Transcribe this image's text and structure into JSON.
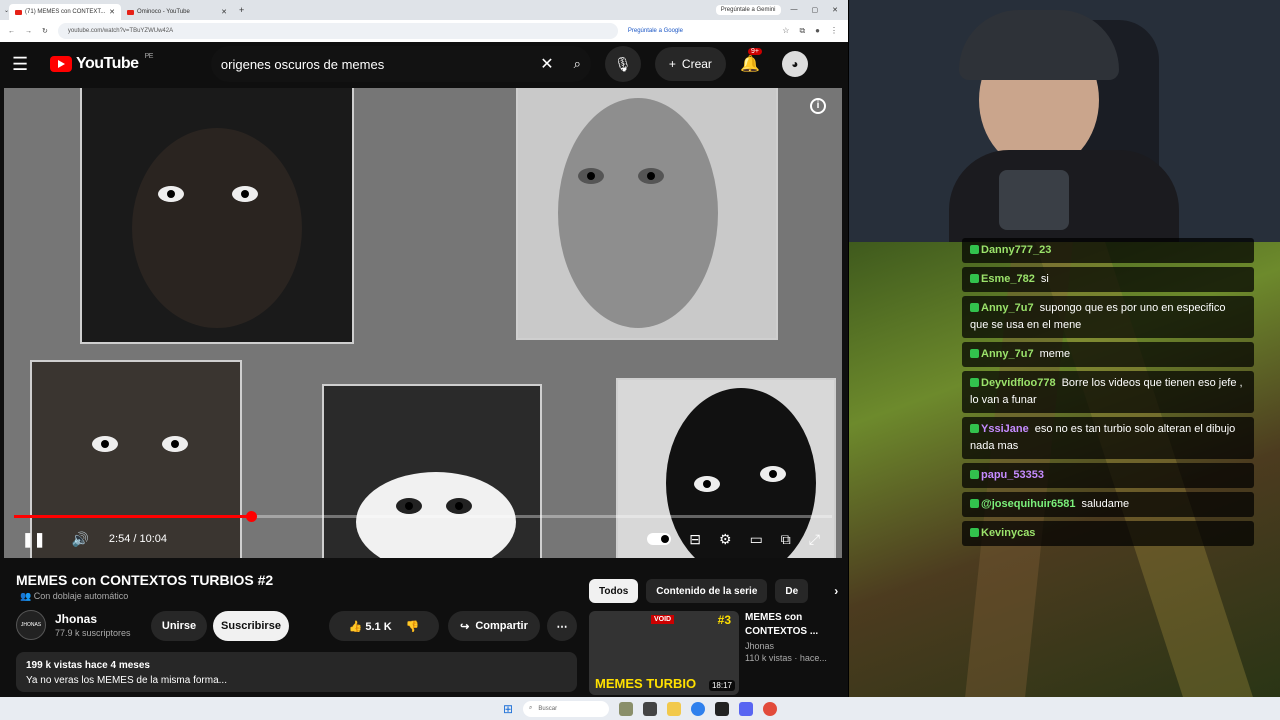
{
  "browser": {
    "tab_active": "(71) MEMES con CONTEXT...",
    "tab_inactive": "Ominoco - YouTube",
    "gemini_tab": "Pregúntale a Gemini",
    "url": "youtube.com/watch?v=TBuYZWUw42A",
    "gemini_omnibox": "Pregúntale a Google"
  },
  "youtube": {
    "logo": "YouTube",
    "region": "PE",
    "search_query": "origenes oscuros  de memes",
    "create_label": "Crear",
    "notif_badge": "9+",
    "player": {
      "time": "2:54 / 10:04",
      "progress": 0.29
    },
    "video": {
      "title": "MEMES con CONTEXTOS TURBIOS #2",
      "dubbing": "Con doblaje automático",
      "channel": "Jhonas",
      "subscribers": "77.9 k suscriptores",
      "join": "Unirse",
      "subscribe": "Suscribirse",
      "likes": "5.1 K",
      "share": "Compartir",
      "views_date": "199 k vistas  hace 4 meses",
      "description": "Ya no veras los MEMES de la misma forma..."
    },
    "chips": [
      "Todos",
      "Contenido de la serie",
      "De"
    ],
    "recommendation": {
      "thumb_text": "MEMES TURBIO",
      "thumb_num": "#3",
      "thumb_badge": "VOID",
      "duration": "18:17",
      "title": "MEMES con CONTEXTOS ...",
      "channel": "Jhonas",
      "meta": "110 k vistas · hace..."
    }
  },
  "chat": [
    {
      "user": "Danny777_23",
      "text": "",
      "color": "#9be36b"
    },
    {
      "user": "Esme_782",
      "text": "si",
      "color": "#9be36b"
    },
    {
      "user": "Anny_7u7",
      "text": "supongo que es por uno en especifico que se usa en el mene",
      "color": "#9be36b"
    },
    {
      "user": "Anny_7u7",
      "text": "meme",
      "color": "#9be36b"
    },
    {
      "user": "Deyvidfloo778",
      "text": "Borre los videos que tienen eso jefe , lo van a funar",
      "color": "#9be36b"
    },
    {
      "user": "YssiJane",
      "text": "eso no es tan turbio solo alteran el dibujo nada mas",
      "color": "#c58bff"
    },
    {
      "user": "papu_53353",
      "text": "",
      "color": "#c58bff"
    },
    {
      "user": "@josequihuir6581",
      "text": "saludame",
      "color": "#7bf07b"
    },
    {
      "user": "Kevinycas",
      "text": "",
      "color": "#9be36b"
    }
  ],
  "taskbar": {
    "search": "Buscar"
  }
}
